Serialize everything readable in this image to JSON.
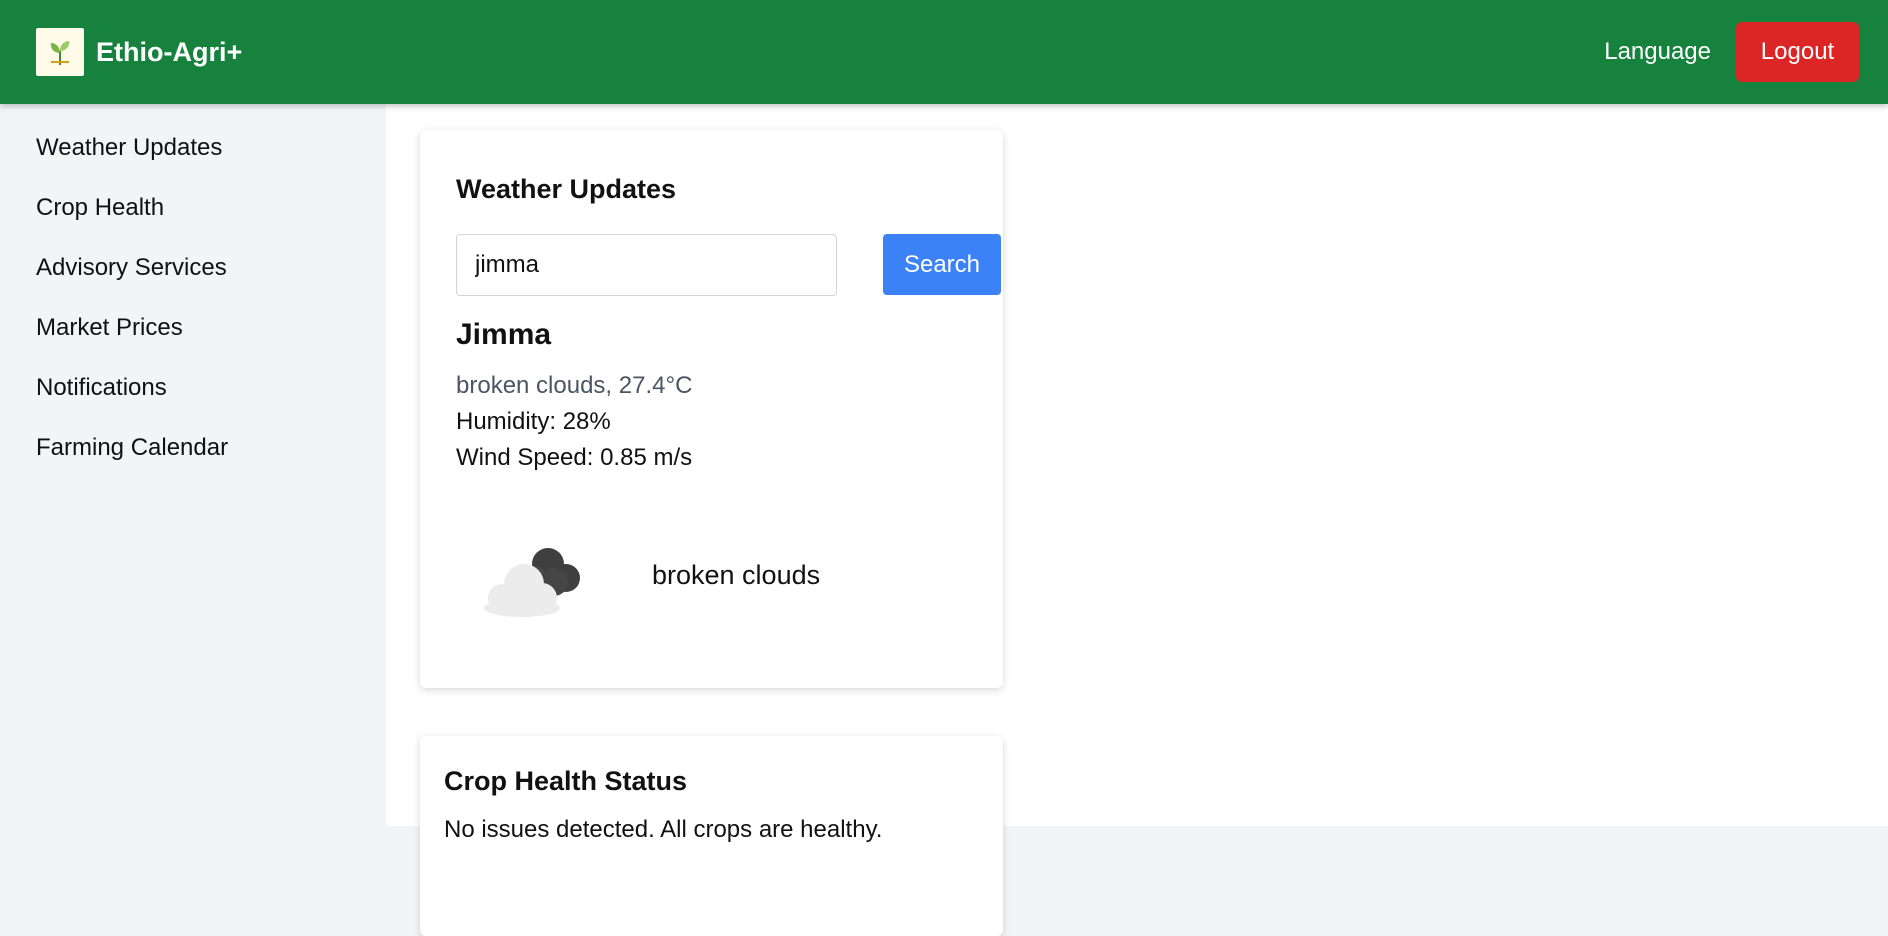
{
  "header": {
    "brand": "Ethio-Agri+",
    "logo_icon": "sprout-logo-icon",
    "language_label": "Language",
    "logout_label": "Logout",
    "colors": {
      "primary": "#16823d",
      "logout": "#dc2626"
    }
  },
  "sidebar": {
    "items": [
      {
        "label": "Weather Updates"
      },
      {
        "label": "Crop Health"
      },
      {
        "label": "Advisory Services"
      },
      {
        "label": "Market Prices"
      },
      {
        "label": "Notifications"
      },
      {
        "label": "Farming Calendar"
      }
    ]
  },
  "weather": {
    "title": "Weather Updates",
    "search_value": "jimma",
    "search_label": "Search",
    "city": "Jimma",
    "description": "broken clouds, 27.4°C",
    "humidity": "Humidity: 28%",
    "wind": "Wind Speed: 0.85 m/s",
    "icon_label": "broken clouds",
    "icon": "broken-clouds-icon",
    "colors": {
      "search": "#3b82f6"
    }
  },
  "crop_health": {
    "title": "Crop Health Status",
    "text": "No issues detected. All crops are healthy."
  }
}
